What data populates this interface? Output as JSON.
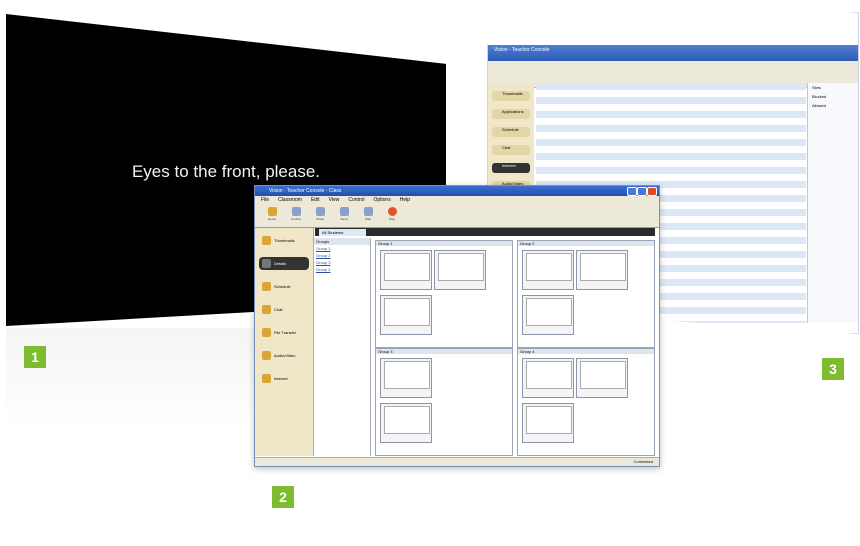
{
  "panel1": {
    "message": "Eyes to the front, please."
  },
  "badges": {
    "one": "1",
    "two": "2",
    "three": "3"
  },
  "window2": {
    "title": "Vision - Teacher Console - Class",
    "menu": [
      "File",
      "Classroom",
      "Edit",
      "View",
      "Control",
      "Options",
      "Help"
    ],
    "toolbar": [
      "Home",
      "Control",
      "Show",
      "Send",
      "Web",
      "Stop"
    ],
    "tab": "All Students",
    "sidebar": [
      "Thumbnails",
      "Details",
      "Schedule",
      "Chat",
      "File Transfer",
      "Audio/Video",
      "Internet"
    ],
    "groups_header": "Groups",
    "group_links": [
      "Group 1",
      "Group 2",
      "Group 3",
      "Group 4"
    ],
    "groups": [
      "Group 1",
      "Group 2",
      "Group 3",
      "Group 4"
    ],
    "status": "Connected"
  },
  "window3": {
    "title": "Vision - Teacher Console",
    "sidebar": [
      "Thumbnails",
      "Applications",
      "Schedule",
      "Chat",
      "Internet",
      "Audio/Video"
    ],
    "right_panel": [
      "Sites",
      "Blocked",
      "Allowed"
    ]
  },
  "colors": {
    "badge": "#7dbb2f",
    "titlebar": "#2d5bb5",
    "sidebar": "#efe7c8"
  }
}
